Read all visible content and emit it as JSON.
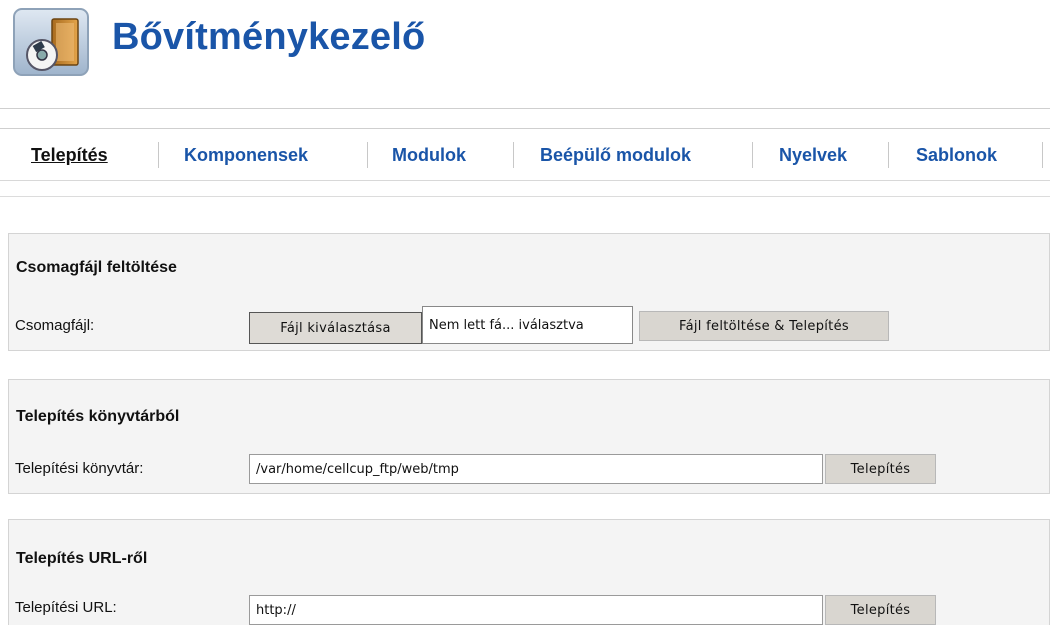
{
  "header": {
    "title": "Bővítménykezelő",
    "icon": "extension-manager-icon"
  },
  "tabs": [
    {
      "label": "Telepítés",
      "active": true
    },
    {
      "label": "Komponensek",
      "active": false
    },
    {
      "label": "Modulok",
      "active": false
    },
    {
      "label": "Beépülő modulok",
      "active": false
    },
    {
      "label": "Nyelvek",
      "active": false
    },
    {
      "label": "Sablonok",
      "active": false
    }
  ],
  "upload": {
    "title": "Csomagfájl feltöltése",
    "label": "Csomagfájl:",
    "choose_button": "Fájl kiválasztása",
    "file_status": "Nem lett fá... iválasztva",
    "submit_button": "Fájl feltöltése & Telepítés"
  },
  "directory": {
    "title": "Telepítés könyvtárból",
    "label": "Telepítési könyvtár:",
    "value": "/var/home/cellcup_ftp/web/tmp",
    "submit_button": "Telepítés"
  },
  "url": {
    "title": "Telepítés URL-ről",
    "label": "Telepítési URL:",
    "value": "http://",
    "submit_button": "Telepítés"
  },
  "colors": {
    "accent": "#1a55a8",
    "panel_bg": "#f4f4f4",
    "button_bg": "#d9d6d0"
  }
}
